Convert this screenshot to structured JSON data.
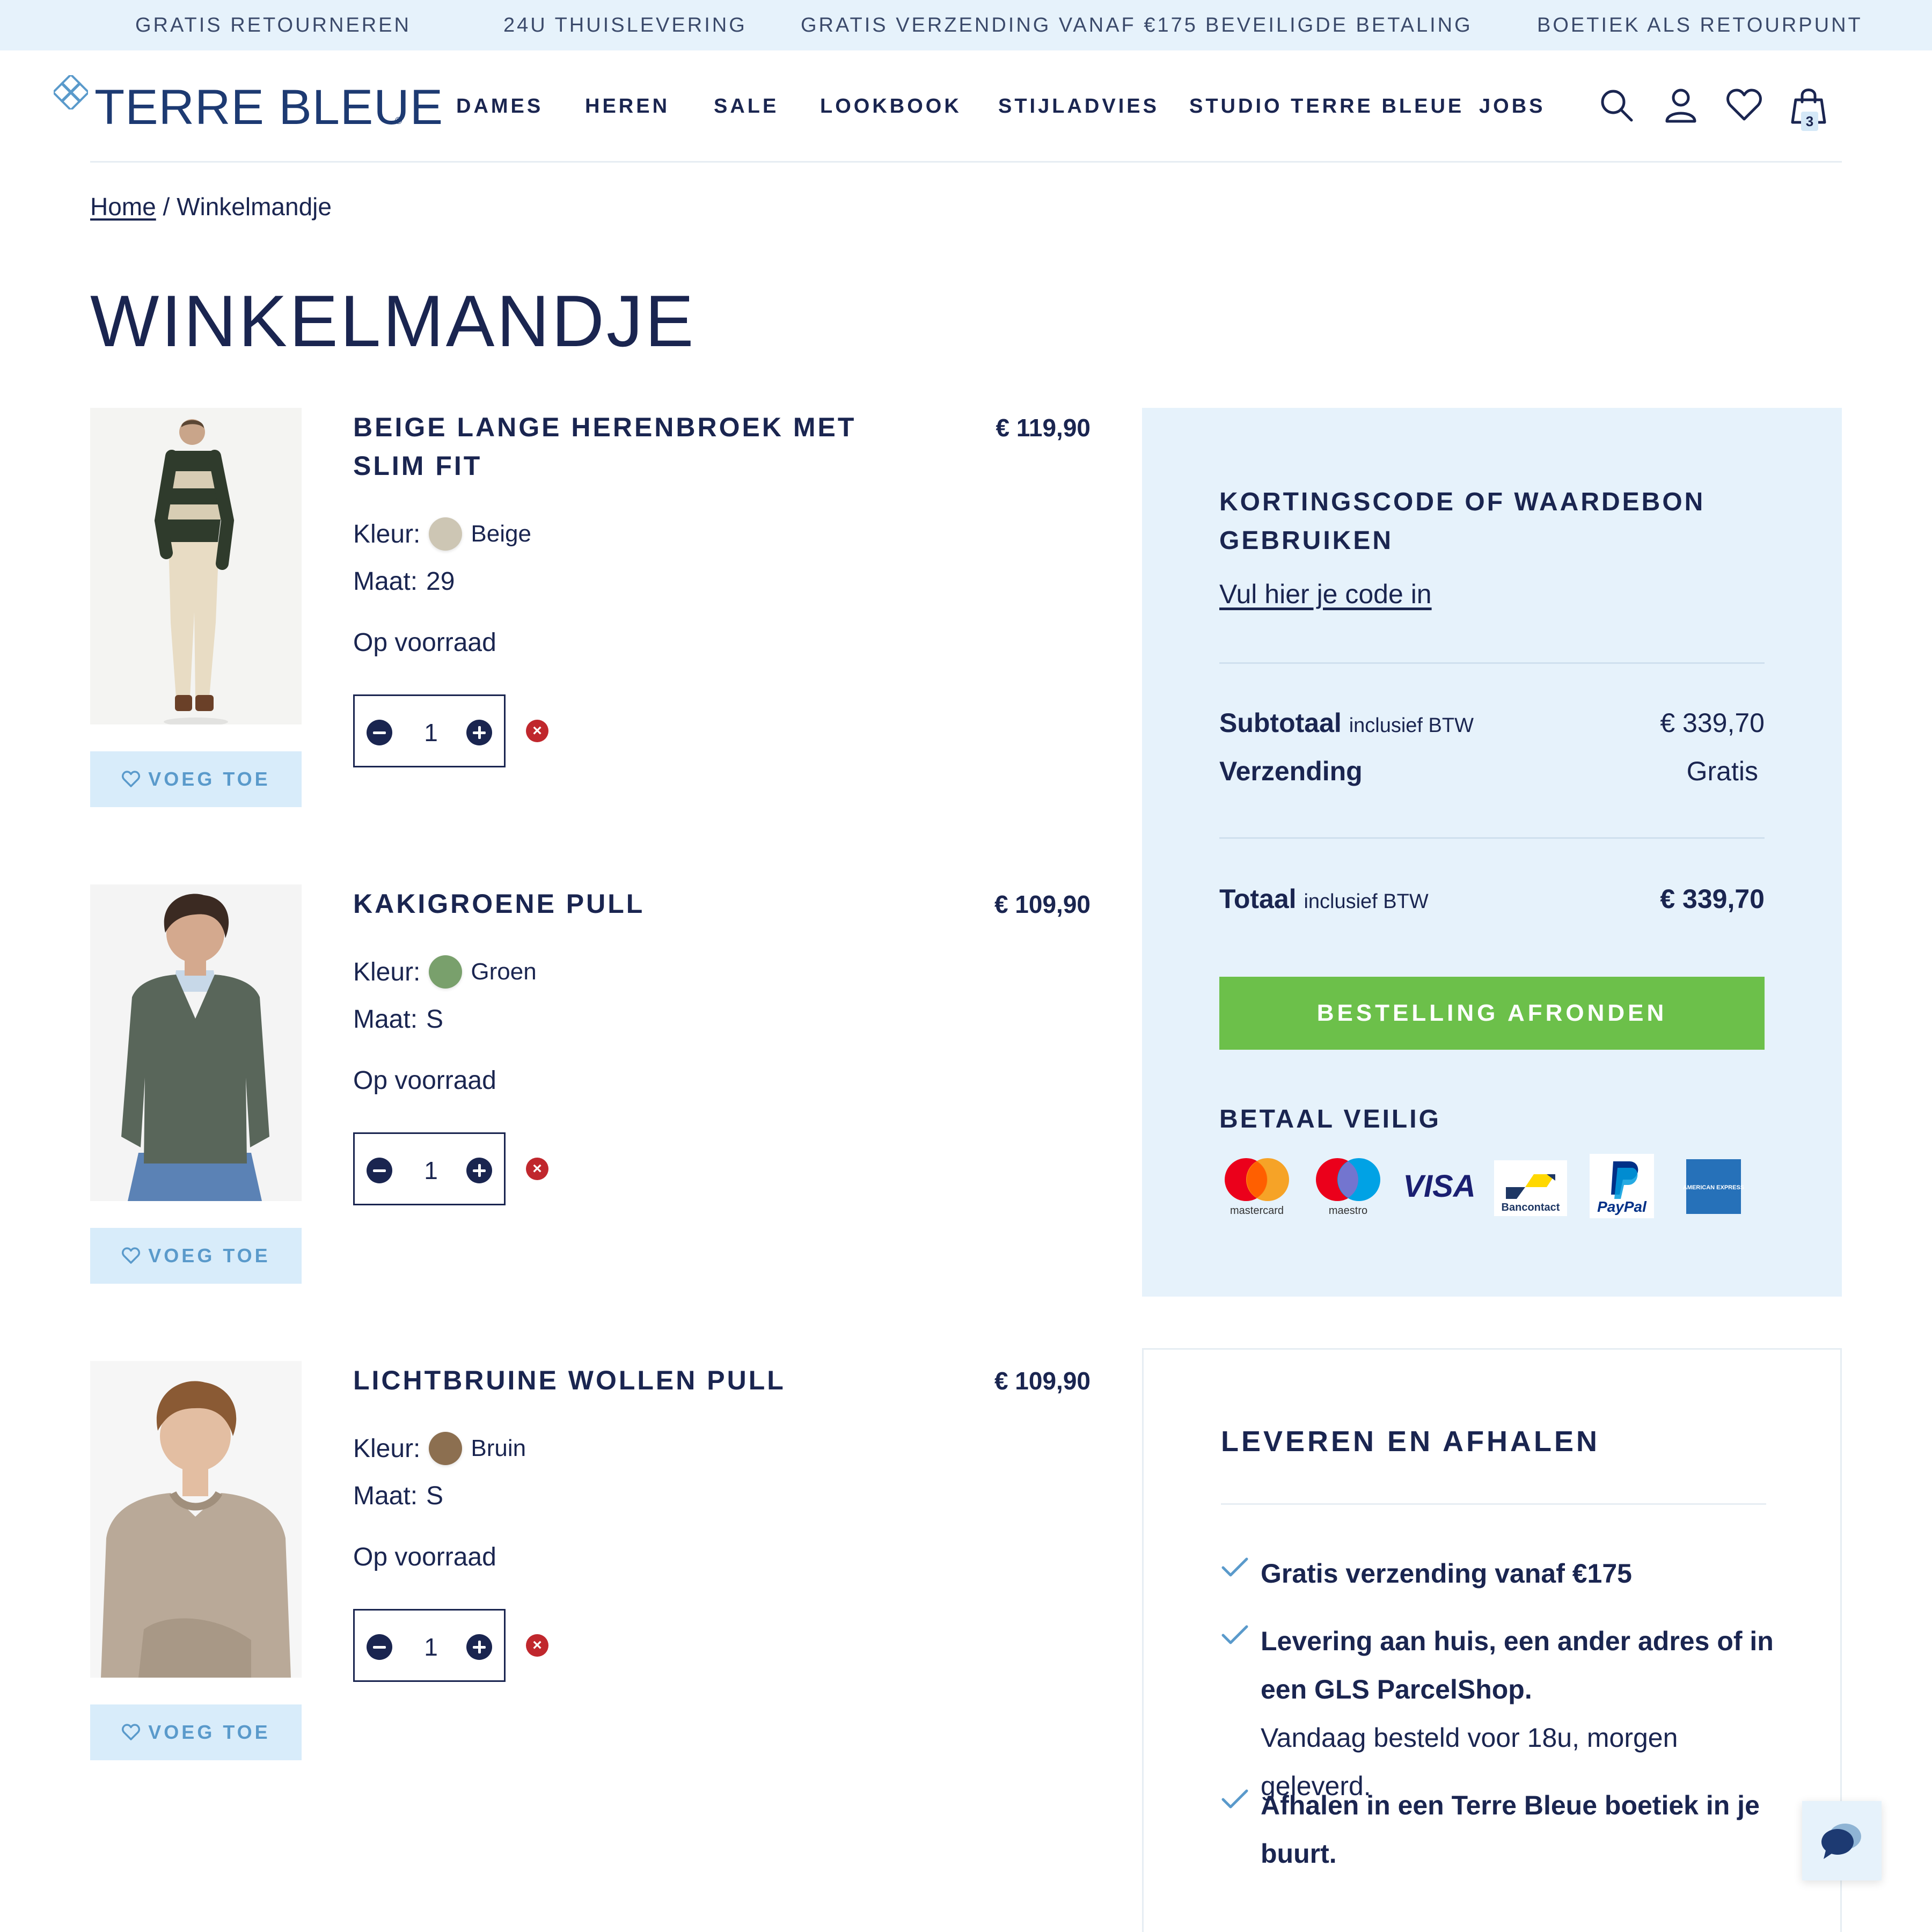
{
  "topbar": {
    "messages": [
      "GRATIS RETOURNEREN",
      "24U THUISLEVERING",
      "GRATIS VERZENDING VANAF €175",
      "BEVEILIGDE BETALING",
      "BOETIEK ALS RETOURPUNT"
    ]
  },
  "header": {
    "logo_text": "TERRE BLEUE",
    "logo_reg": "®",
    "nav": [
      "DAMES",
      "HEREN",
      "SALE",
      "LOOKBOOK",
      "STIJLADVIES",
      "STUDIO TERRE BLEUE",
      "JOBS"
    ],
    "icons": [
      "search-icon",
      "account-icon",
      "heart-icon",
      "shopping-bag-icon"
    ],
    "cart_count": "3"
  },
  "breadcrumb": {
    "home": "Home",
    "separator": " / ",
    "current": "Winkelmandje"
  },
  "page_title": "WINKELMANDJE",
  "cart": {
    "color_label": "Kleur:",
    "size_label": "Maat:",
    "wishlist_label": "VOEG TOE",
    "items": [
      {
        "title": "BEIGE LANGE HERENBROEK MET SLIM FIT",
        "price": "€ 119,90",
        "color_name": "Beige",
        "color_hex": "#cdc6b4",
        "size": "29",
        "stock": "Op voorraad",
        "qty": "1"
      },
      {
        "title": "KAKIGROENE PULL",
        "price": "€ 109,90",
        "color_name": "Groen",
        "color_hex": "#79a06c",
        "size": "S",
        "stock": "Op voorraad",
        "qty": "1"
      },
      {
        "title": "LICHTBRUINE WOLLEN PULL",
        "price": "€ 109,90",
        "color_name": "Bruin",
        "color_hex": "#8c6f50",
        "size": "S",
        "stock": "Op voorraad",
        "qty": "1"
      }
    ]
  },
  "summary": {
    "discount_heading": "KORTINGSCODE OF WAARDEBON GEBRUIKEN",
    "discount_link": "Vul hier je code in",
    "subtotal_label": "Subtotaal",
    "subtotal_note": "inclusief BTW",
    "subtotal_value": "€ 339,70",
    "shipping_label": "Verzending",
    "shipping_value": "Gratis",
    "total_label": "Totaal",
    "total_note": "inclusief BTW",
    "total_value": "€ 339,70",
    "checkout_button": "BESTELLING AFRONDEN",
    "pay_heading": "BETAAL VEILIG",
    "payment_methods": [
      "mastercard",
      "maestro",
      "VISA",
      "Bancontact",
      "PayPal",
      "AMERICAN EXPRESS"
    ]
  },
  "delivery": {
    "heading": "LEVEREN EN AFHALEN",
    "items": [
      {
        "bold": "Gratis verzending vanaf €175",
        "sub": ""
      },
      {
        "bold": "Levering aan huis, een ander adres of in een GLS ParcelShop.",
        "sub": "Vandaag besteld voor 18u, morgen geleverd."
      },
      {
        "bold": "Afhalen in een Terre Bleue boetiek in je buurt.",
        "sub": ""
      }
    ]
  },
  "colors": {
    "navy": "#1a2550",
    "light_blue": "#e6f2fb",
    "wishlist_bg": "#d8ecfa",
    "wishlist_text": "#5a9acb",
    "checkout_green": "#6cc04a",
    "remove_red": "#c0272d"
  }
}
